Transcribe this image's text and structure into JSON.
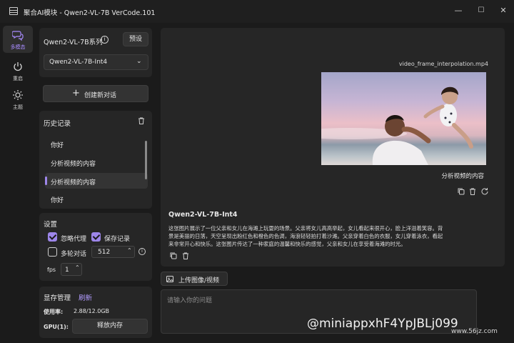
{
  "window": {
    "title": "聚合AI模块 - Qwen2-VL-7B VerCode.101",
    "minimize": "—",
    "maximize": "☐",
    "close": "✕"
  },
  "nav": [
    {
      "label": "多模态",
      "icon": "chat-bubbles-icon",
      "active": true
    },
    {
      "label": "重启",
      "icon": "power-icon"
    },
    {
      "label": "主题",
      "icon": "sun-icon"
    }
  ],
  "model": {
    "series_label": "Qwen2-VL-7B系列",
    "preset_button": "预设",
    "selected": "Qwen2-VL-7B-Int4"
  },
  "new_chat_button": "创建新对话",
  "history": {
    "title": "历史记录",
    "items": [
      "你好",
      "分析视频的内容",
      "分析视频的内容",
      "你好"
    ],
    "selected_index": 2
  },
  "settings": {
    "title": "设置",
    "ignore_proxy": "忽略代理",
    "save_history": "保存记录",
    "multi_turn": "多轮对话",
    "multi_turn_value": "512",
    "fps_label": "fps",
    "fps_value": "1"
  },
  "memory": {
    "title": "显存管理",
    "refresh": "刷新",
    "usage_label": "使用率:",
    "usage_value": "2.88/12.0GB",
    "gpu_label": "GPU(1):",
    "release_button": "释放内存"
  },
  "chat": {
    "user_file": "video_frame_interpolation.mp4",
    "user_text": "分析视频的内容",
    "assistant_name": "Qwen2-VL-7B-Int4",
    "assistant_lines": [
      "这张图片展示了一位父亲和女儿在海滩上玩耍的场景。父亲将女儿高高举起，女儿看起来很开心，脸上洋溢着笑容。背",
      "景是美丽的日落，天空呈现出粉红色和橙色的色调，海浪轻轻拍打着沙滩。父亲穿着白色的衣服，女儿穿着泳衣，看起",
      "来非常开心和快乐。这张图片传达了一种家庭的温馨和快乐的感觉，父亲和女儿在享受着海滩的时光。"
    ]
  },
  "upload_button": "上传图像/视频",
  "input_placeholder": "请输入你的问题",
  "watermark": "@miniappxhF4YpJBLj099",
  "watermark_site": "www.56jz.com",
  "colors": {
    "accent": "#9d86ea",
    "background": "#1b1b1b",
    "panel": "#262626"
  }
}
